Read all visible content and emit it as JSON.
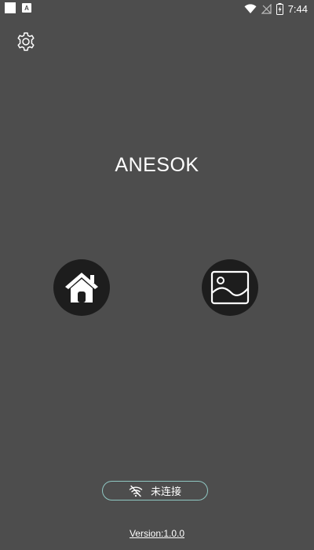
{
  "status_bar": {
    "time": "7:44",
    "app_notification_letter": "A",
    "icons": [
      "white-square-icon",
      "app-notification-icon",
      "wifi-icon",
      "no-signal-icon",
      "battery-charging-icon"
    ]
  },
  "header": {
    "settings_icon": "gear-icon"
  },
  "main": {
    "title": "ANESOK",
    "buttons": [
      {
        "icon": "home-icon"
      },
      {
        "icon": "gallery-icon"
      }
    ]
  },
  "connection": {
    "status_text": "未连接",
    "icon": "wifi-off-icon",
    "border_color": "#8fc7c2"
  },
  "footer": {
    "version": "Version:1.0.0"
  },
  "colors": {
    "background": "#4d4d4d",
    "button_background": "#1d1d1d",
    "text": "#ffffff"
  }
}
